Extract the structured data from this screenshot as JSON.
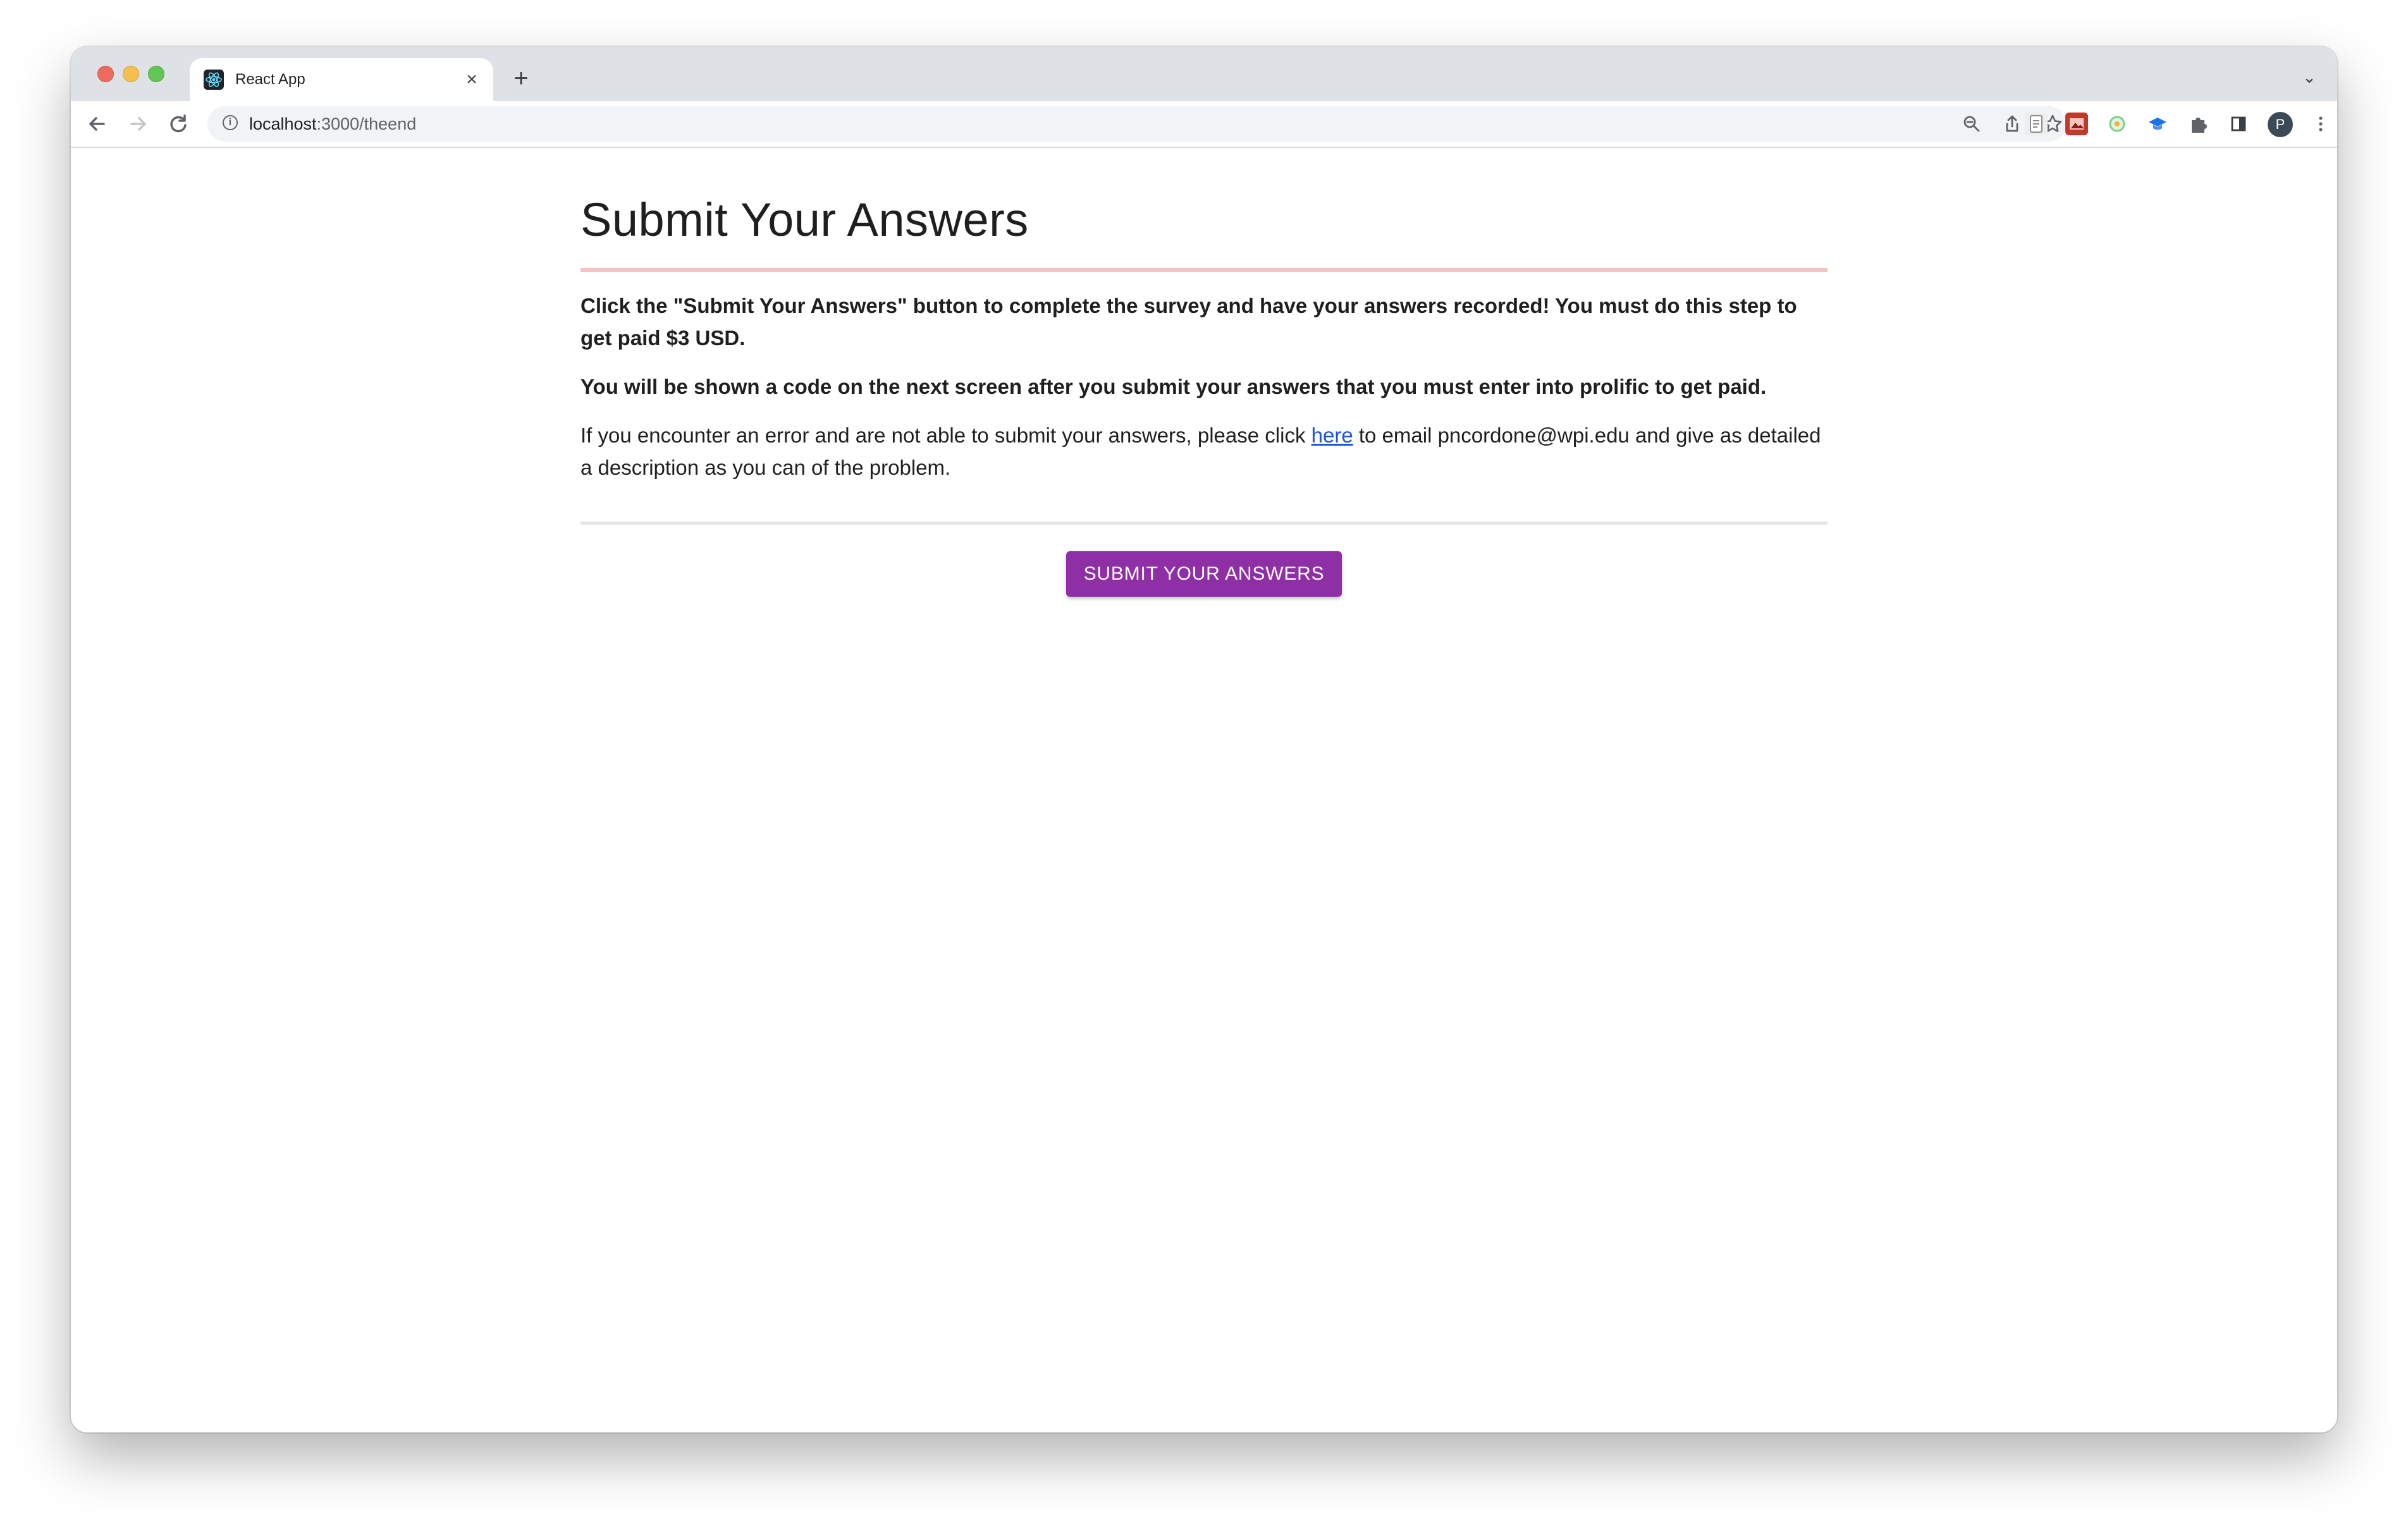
{
  "browser": {
    "tab": {
      "title": "React App",
      "close": "×"
    },
    "new_tab": "+",
    "tab_menu": "⌄",
    "address": {
      "host": "localhost",
      "path": ":3000/theend"
    },
    "avatar_letter": "P",
    "icons": [
      "back-arrow-icon",
      "forward-arrow-icon",
      "reload-icon",
      "info-icon",
      "zoom-icon",
      "share-icon",
      "bookmark-star-icon",
      "extension-icons",
      "puzzle-icon",
      "side-panel-icon",
      "kebab-menu-icon"
    ]
  },
  "page": {
    "title": "Submit Your Answers",
    "para1": "Click the \"Submit Your Answers\" button to complete the survey and have your answers recorded! You must do this step to get paid $3 USD.",
    "para2": "You will be shown a code on the next screen after you submit your answers that you must enter into prolific to get paid.",
    "para3_before": "If you encounter an error and are not able to submit your answers, please click ",
    "para3_link": "here",
    "para3_after": " to email pncordone@wpi.edu and give as detailed a description as you can of the problem.",
    "submit_label": "SUBMIT YOUR ANSWERS",
    "accent_color": "#8e2fa6",
    "rule_color": "#f5c3c3"
  }
}
